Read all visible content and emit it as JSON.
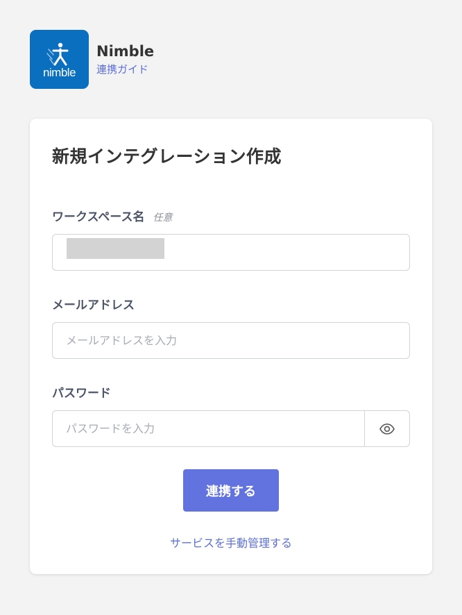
{
  "app": {
    "logo_text": "nimble",
    "name": "Nimble",
    "guide_link": "連携ガイド"
  },
  "form": {
    "title": "新規インテグレーション作成",
    "workspace": {
      "label": "ワークスペース名",
      "optional_tag": "任意",
      "value": ""
    },
    "email": {
      "label": "メールアドレス",
      "placeholder": "メールアドレスを入力"
    },
    "password": {
      "label": "パスワード",
      "placeholder": "パスワードを入力",
      "toggle_icon": "eye-icon"
    },
    "submit_label": "連携する",
    "manual_link": "サービスを手動管理する"
  },
  "colors": {
    "brand": "#0a6fbf",
    "accent": "#6272df",
    "link": "#5b6fd8"
  }
}
